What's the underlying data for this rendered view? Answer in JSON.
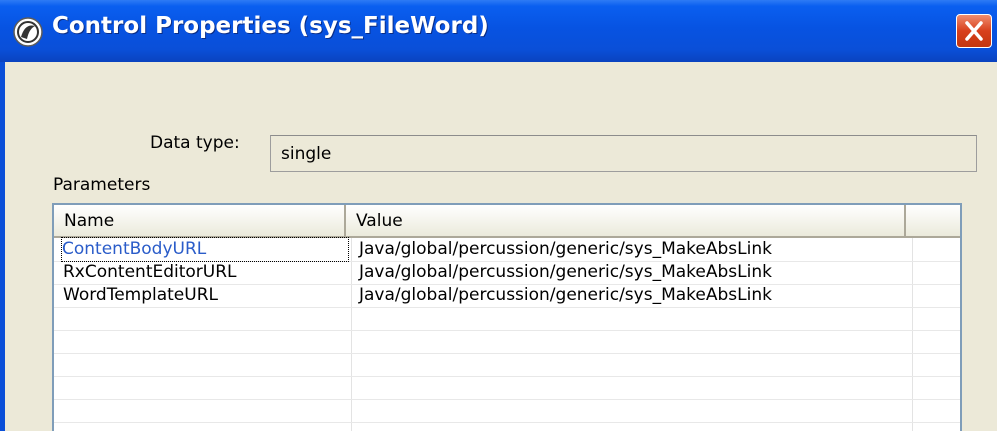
{
  "window": {
    "title": "Control Properties (sys_FileWord)"
  },
  "form": {
    "data_type_label": "Data type:",
    "data_type_value": "single",
    "parameters_label": "Parameters"
  },
  "table": {
    "columns": [
      "Name",
      "Value",
      ""
    ],
    "rows": [
      {
        "name": "ContentBodyURL",
        "value": "Java/global/percussion/generic/sys_MakeAbsLink"
      },
      {
        "name": "RxContentEditorURL",
        "value": "Java/global/percussion/generic/sys_MakeAbsLink"
      },
      {
        "name": "WordTemplateURL",
        "value": "Java/global/percussion/generic/sys_MakeAbsLink"
      },
      {
        "name": "",
        "value": ""
      },
      {
        "name": "",
        "value": ""
      },
      {
        "name": "",
        "value": ""
      },
      {
        "name": "",
        "value": ""
      },
      {
        "name": "",
        "value": ""
      }
    ],
    "selected_row": 0
  },
  "colors": {
    "titlebar": "#0a4fd8",
    "close_button": "#d8401c",
    "selected_text": "#2a5cc9",
    "dialog_bg": "#ece9d8"
  }
}
